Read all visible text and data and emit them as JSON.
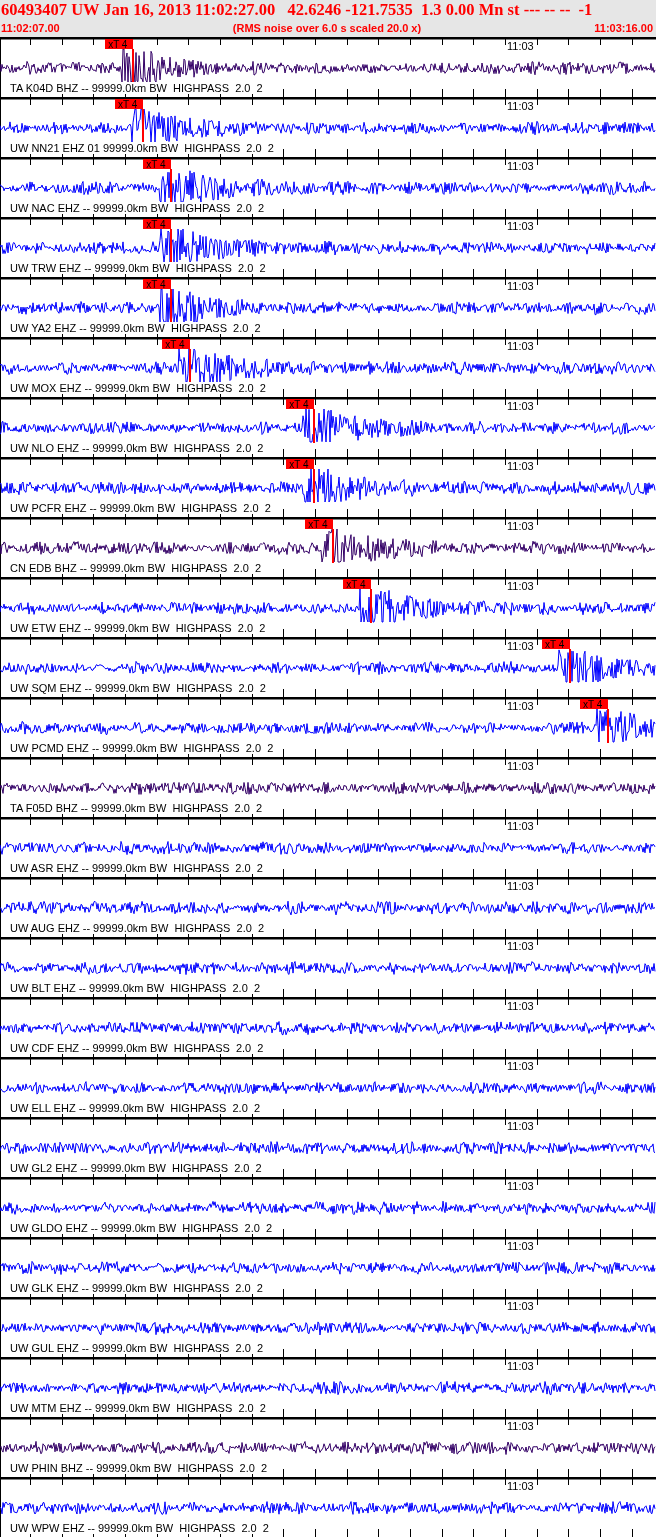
{
  "header": {
    "summary": "60493407 UW Jan 16, 2013 11:02:27.00   42.6246 -121.7535  1.3 0.00 Mn st --- -- --  -1",
    "start_time": "11:02:07.00",
    "caption": "(RMS noise over 6.0 s scaled 20.0 x)",
    "end_time": "11:03:16.00"
  },
  "traces": [
    {
      "label": "TA K04D BHZ -- 99999.0km BW  HIGHPASS  2.0  2",
      "time_label": "11:03",
      "color": "#330066",
      "pick": {
        "label": "xT 4",
        "level": 0.203
      }
    },
    {
      "label": "UW NN21 EHZ 01 99999.0km BW  HIGHPASS  2.0  2",
      "time_label": "11:03",
      "color": "#0000ff",
      "pick": {
        "label": "xT 4",
        "level": 0.218
      }
    },
    {
      "label": "UW NAC EHZ -- 99999.0km BW  HIGHPASS  2.0  2",
      "time_label": "11:03",
      "color": "#0000ff",
      "pick": {
        "label": "xT 4",
        "level": 0.261
      }
    },
    {
      "label": "UW TRW EHZ -- 99999.0km BW  HIGHPASS  2.0  2",
      "time_label": "11:03",
      "color": "#0000ff",
      "pick": {
        "label": "xT 4",
        "level": 0.261
      }
    },
    {
      "label": "UW YA2 EHZ -- 99999.0km BW  HIGHPASS  2.0  2",
      "time_label": "11:03",
      "color": "#0000ff",
      "pick": {
        "label": "xT 4",
        "level": 0.261
      }
    },
    {
      "label": "UW MOX EHZ -- 99999.0km BW  HIGHPASS  2.0  2",
      "time_label": "11:03",
      "color": "#0000ff",
      "pick": {
        "label": "xT 4",
        "level": 0.29
      }
    },
    {
      "label": "UW NLO EHZ -- 99999.0km BW  HIGHPASS  2.0  2",
      "time_label": "11:03",
      "color": "#0000ff",
      "pick": {
        "label": "xT 4",
        "level": 0.479
      }
    },
    {
      "label": "UW PCFR EHZ -- 99999.0km BW  HIGHPASS  2.0  2",
      "time_label": "11:03",
      "color": "#0000ff",
      "pick": {
        "label": "xT 4",
        "level": 0.479
      }
    },
    {
      "label": "CN EDB BHZ -- 99999.0km BW  HIGHPASS  2.0  2",
      "time_label": "11:03",
      "color": "#330066",
      "pick": {
        "label": "xT 4",
        "level": 0.508
      }
    },
    {
      "label": "UW ETW EHZ -- 99999.0km BW  HIGHPASS  2.0  2",
      "time_label": "11:03",
      "color": "#0000ff",
      "pick": {
        "label": "xT 4",
        "level": 0.566
      }
    },
    {
      "label": "UW SQM EHZ -- 99999.0km BW  HIGHPASS  2.0  2",
      "time_label": "11:03",
      "color": "#0000ff",
      "pick": {
        "label": "xT 4",
        "level": 0.869
      }
    },
    {
      "label": "UW PCMD EHZ -- 99999.0km BW  HIGHPASS  2.0  2",
      "time_label": "11:03",
      "color": "#0000ff",
      "pick": {
        "label": "xT 4",
        "level": 0.927
      }
    },
    {
      "label": "TA F05D BHZ -- 99999.0km BW  HIGHPASS  2.0  2",
      "time_label": "11:03",
      "color": "#330066"
    },
    {
      "label": "UW ASR EHZ -- 99999.0km BW  HIGHPASS  2.0  2",
      "time_label": "11:03",
      "color": "#0000ff"
    },
    {
      "label": "UW AUG EHZ -- 99999.0km BW  HIGHPASS  2.0  2",
      "time_label": "11:03",
      "color": "#0000ff"
    },
    {
      "label": "UW BLT EHZ -- 99999.0km BW  HIGHPASS  2.0  2",
      "time_label": "11:03",
      "color": "#0000ff"
    },
    {
      "label": "UW CDF EHZ -- 99999.0km BW  HIGHPASS  2.0  2",
      "time_label": "11:03",
      "color": "#0000ff"
    },
    {
      "label": "UW ELL EHZ -- 99999.0km BW  HIGHPASS  2.0  2",
      "time_label": "11:03",
      "color": "#0000ff"
    },
    {
      "label": "UW GL2 EHZ -- 99999.0km BW  HIGHPASS  2.0  2",
      "time_label": "11:03",
      "color": "#0000ff"
    },
    {
      "label": "UW GLDO EHZ -- 99999.0km BW  HIGHPASS  2.0  2",
      "time_label": "11:03",
      "color": "#0000ff"
    },
    {
      "label": "UW GLK EHZ -- 99999.0km BW  HIGHPASS  2.0  2",
      "time_label": "11:03",
      "color": "#0000ff"
    },
    {
      "label": "UW GUL EHZ -- 99999.0km BW  HIGHPASS  2.0  2",
      "time_label": "11:03",
      "color": "#0000ff"
    },
    {
      "label": "UW MTM EHZ -- 99999.0km BW  HIGHPASS  2.0  2",
      "time_label": "11:03",
      "color": "#0000ff"
    },
    {
      "label": "UW PHIN BHZ -- 99999.0km BW  HIGHPASS  2.0  2",
      "time_label": "11:03",
      "color": "#330066"
    },
    {
      "label": "UW WPW EHZ -- 99999.0km BW  HIGHPASS  2.0  2",
      "time_label": "11:03",
      "color": "#0000ff"
    }
  ]
}
